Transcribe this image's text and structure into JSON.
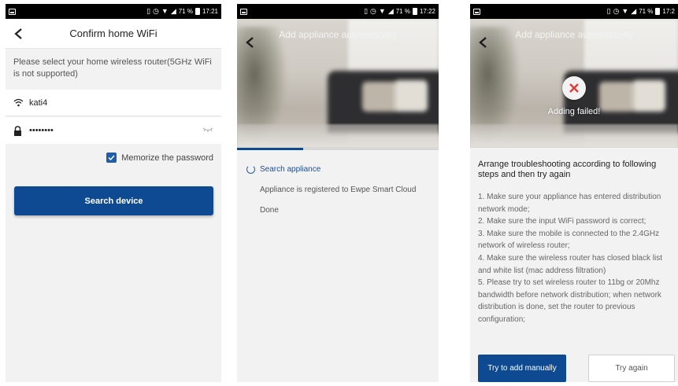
{
  "status_bar": {
    "battery_text": "71 %",
    "time_1": "17:21",
    "time_2": "17:22",
    "time_3": "17:2"
  },
  "confirm_wifi": {
    "title": "Confirm home WiFi",
    "hint": "Please select your home wireless router(5GHz WiFi is not supported)",
    "wifi_name": "kati4",
    "password_masked": "••••••••",
    "memorize_label": "Memorize the password",
    "memorize_checked": true,
    "search_button": "Search device"
  },
  "add_auto": {
    "title": "Add appliance automatically",
    "progress": 0.33,
    "steps": [
      {
        "label": "Search appliance",
        "state": "active"
      },
      {
        "label": "Appliance is registered to Ewpe Smart Cloud",
        "state": "pending"
      },
      {
        "label": "Done",
        "state": "pending"
      }
    ]
  },
  "add_failed": {
    "title": "Add appliance automatically",
    "status": "Adding failed!",
    "heading": "Arrange troubleshooting according to following steps and then try again",
    "items": [
      "1. Make sure your appliance has entered distribution network mode;",
      "2. Make sure the input WiFi password is correct;",
      "3. Make sure the mobile is connected to the 2.4GHz network of wireless router;",
      "4. Make sure the wireless router has closed black list and white list (mac address filtration)",
      "5. Please try to set wireless router to 11bg or 20Mhz bandwidth before network distribution; when network distribution is done, set the router to previous configuration;"
    ],
    "manual_button": "Try to add manually",
    "retry_button": "Try again"
  },
  "colors": {
    "primary": "#0d4a91",
    "error": "#e53935"
  }
}
